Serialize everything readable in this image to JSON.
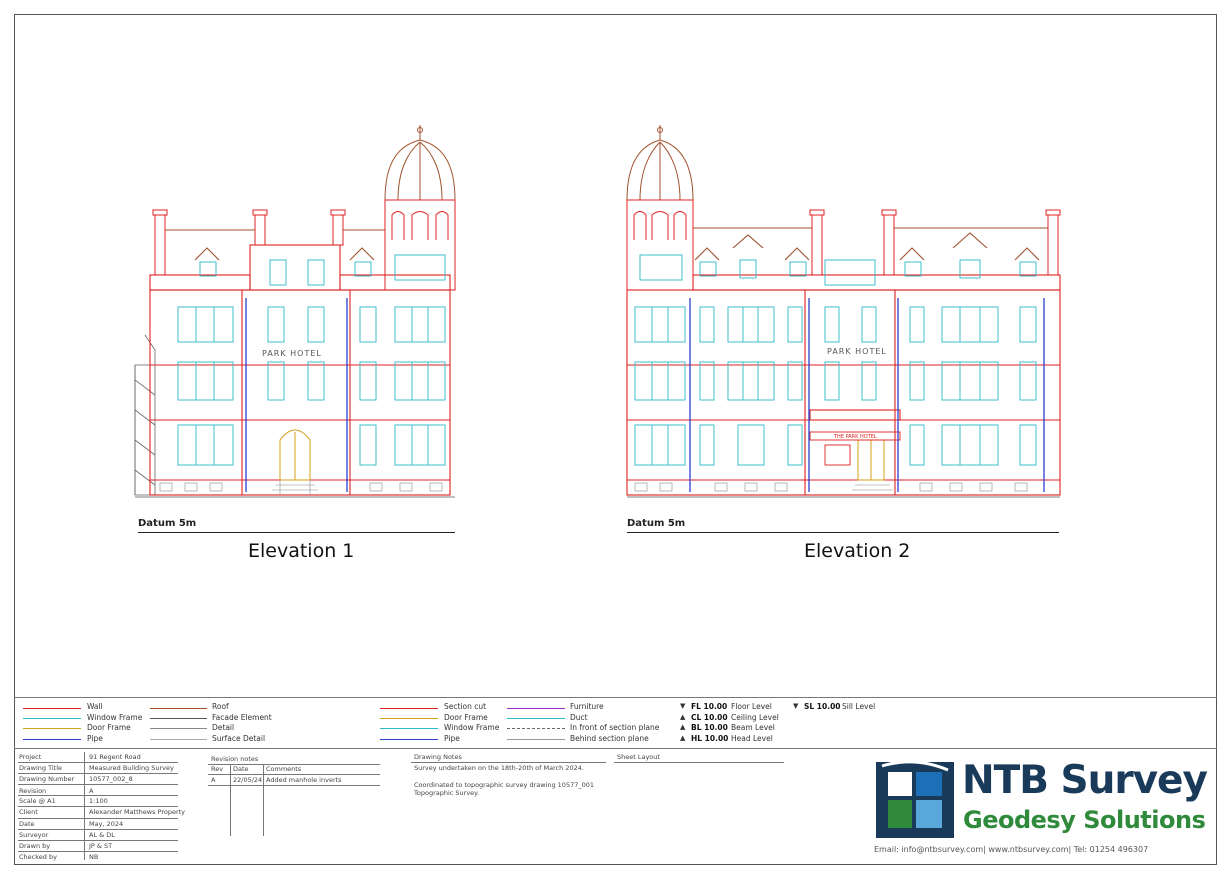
{
  "elevations": [
    {
      "datum": "Datum 5m",
      "title": "Elevation 1",
      "facade_text": "PARK HOTEL"
    },
    {
      "datum": "Datum 5m",
      "title": "Elevation 2",
      "facade_text": "PARK HOTEL",
      "sign_text": "THE PARK HOTEL"
    }
  ],
  "legend": {
    "col1": [
      {
        "label": "Wall",
        "color": "#e02020",
        "style": "solid"
      },
      {
        "label": "Window Frame",
        "color": "#2bb8c8",
        "style": "solid"
      },
      {
        "label": "Door Frame",
        "color": "#d4a017",
        "style": "solid"
      },
      {
        "label": "Pipe",
        "color": "#2a3fd0",
        "style": "solid"
      }
    ],
    "col2": [
      {
        "label": "Roof",
        "color": "#a0522d",
        "style": "solid"
      },
      {
        "label": "Facade Element",
        "color": "#555555",
        "style": "solid"
      },
      {
        "label": "Detail",
        "color": "#888888",
        "style": "solid"
      },
      {
        "label": "Surface Detail",
        "color": "#aaaaaa",
        "style": "solid"
      }
    ],
    "col3": [
      {
        "label": "Section cut",
        "color": "#e02020",
        "style": "solid"
      },
      {
        "label": "Door Frame",
        "color": "#d4a017",
        "style": "solid"
      },
      {
        "label": "Window Frame",
        "color": "#2bb8c8",
        "style": "solid"
      },
      {
        "label": "Pipe",
        "color": "#2a3fd0",
        "style": "solid"
      }
    ],
    "col4": [
      {
        "label": "Furniture",
        "color": "#9b30c8",
        "style": "solid"
      },
      {
        "label": "Duct",
        "color": "#2bb8c8",
        "style": "solid"
      },
      {
        "label": "In front of section plane",
        "color": "#666666",
        "style": "dashed"
      },
      {
        "label": "Behind section plane",
        "color": "#999999",
        "style": "solid"
      }
    ],
    "levels": [
      {
        "code": "FL 10.00",
        "label": "Floor Level",
        "dir": "down"
      },
      {
        "code": "CL 10.00",
        "label": "Ceiling Level",
        "dir": "up"
      },
      {
        "code": "BL 10.00",
        "label": "Beam Level",
        "dir": "up"
      },
      {
        "code": "HL 10.00",
        "label": "Head Level",
        "dir": "up"
      }
    ],
    "sill": {
      "code": "SL 10.00",
      "label": "Sill Level"
    }
  },
  "title_block": {
    "fields": [
      {
        "key": "Project",
        "value": "91 Regent Road"
      },
      {
        "key": "Drawing Title",
        "value": "Measured Building Survey"
      },
      {
        "key": "Drawing Number",
        "value": "10577_002_8"
      },
      {
        "key": "Revision",
        "value": "A"
      },
      {
        "key": "Scale @ A1",
        "value": "1:100"
      },
      {
        "key": "Client",
        "value": "Alexander Matthews Property"
      },
      {
        "key": "Date",
        "value": "May, 2024"
      },
      {
        "key": "Surveyor",
        "value": "AL & DL"
      },
      {
        "key": "Drawn by",
        "value": "JP & ST"
      },
      {
        "key": "Checked by",
        "value": "NB"
      }
    ],
    "revision_notes": {
      "heading": "Revision notes",
      "columns": [
        "Rev",
        "Date",
        "Comments"
      ],
      "rows": [
        [
          "A",
          "22/05/24",
          "Added manhole inverts"
        ]
      ]
    },
    "drawing_notes": {
      "heading": "Drawing Notes",
      "lines": [
        "Survey undertaken on the 18th-20th of March 2024.",
        "",
        "Coordinated to topographic survey drawing 10577_001",
        "Topographic Survey."
      ]
    },
    "sheet_layout": {
      "heading": "Sheet Layout"
    }
  },
  "company": {
    "name": "NTB Survey",
    "tagline": "Geodesy Solutions",
    "contact": "Email: info@ntbsurvey.com| www.ntbsurvey.com| Tel: 01254 496307",
    "colors": {
      "navy": "#1a3a5a",
      "blue": "#1d6fb8",
      "green": "#2f8a3c",
      "light_blue": "#5aa7dc"
    }
  }
}
